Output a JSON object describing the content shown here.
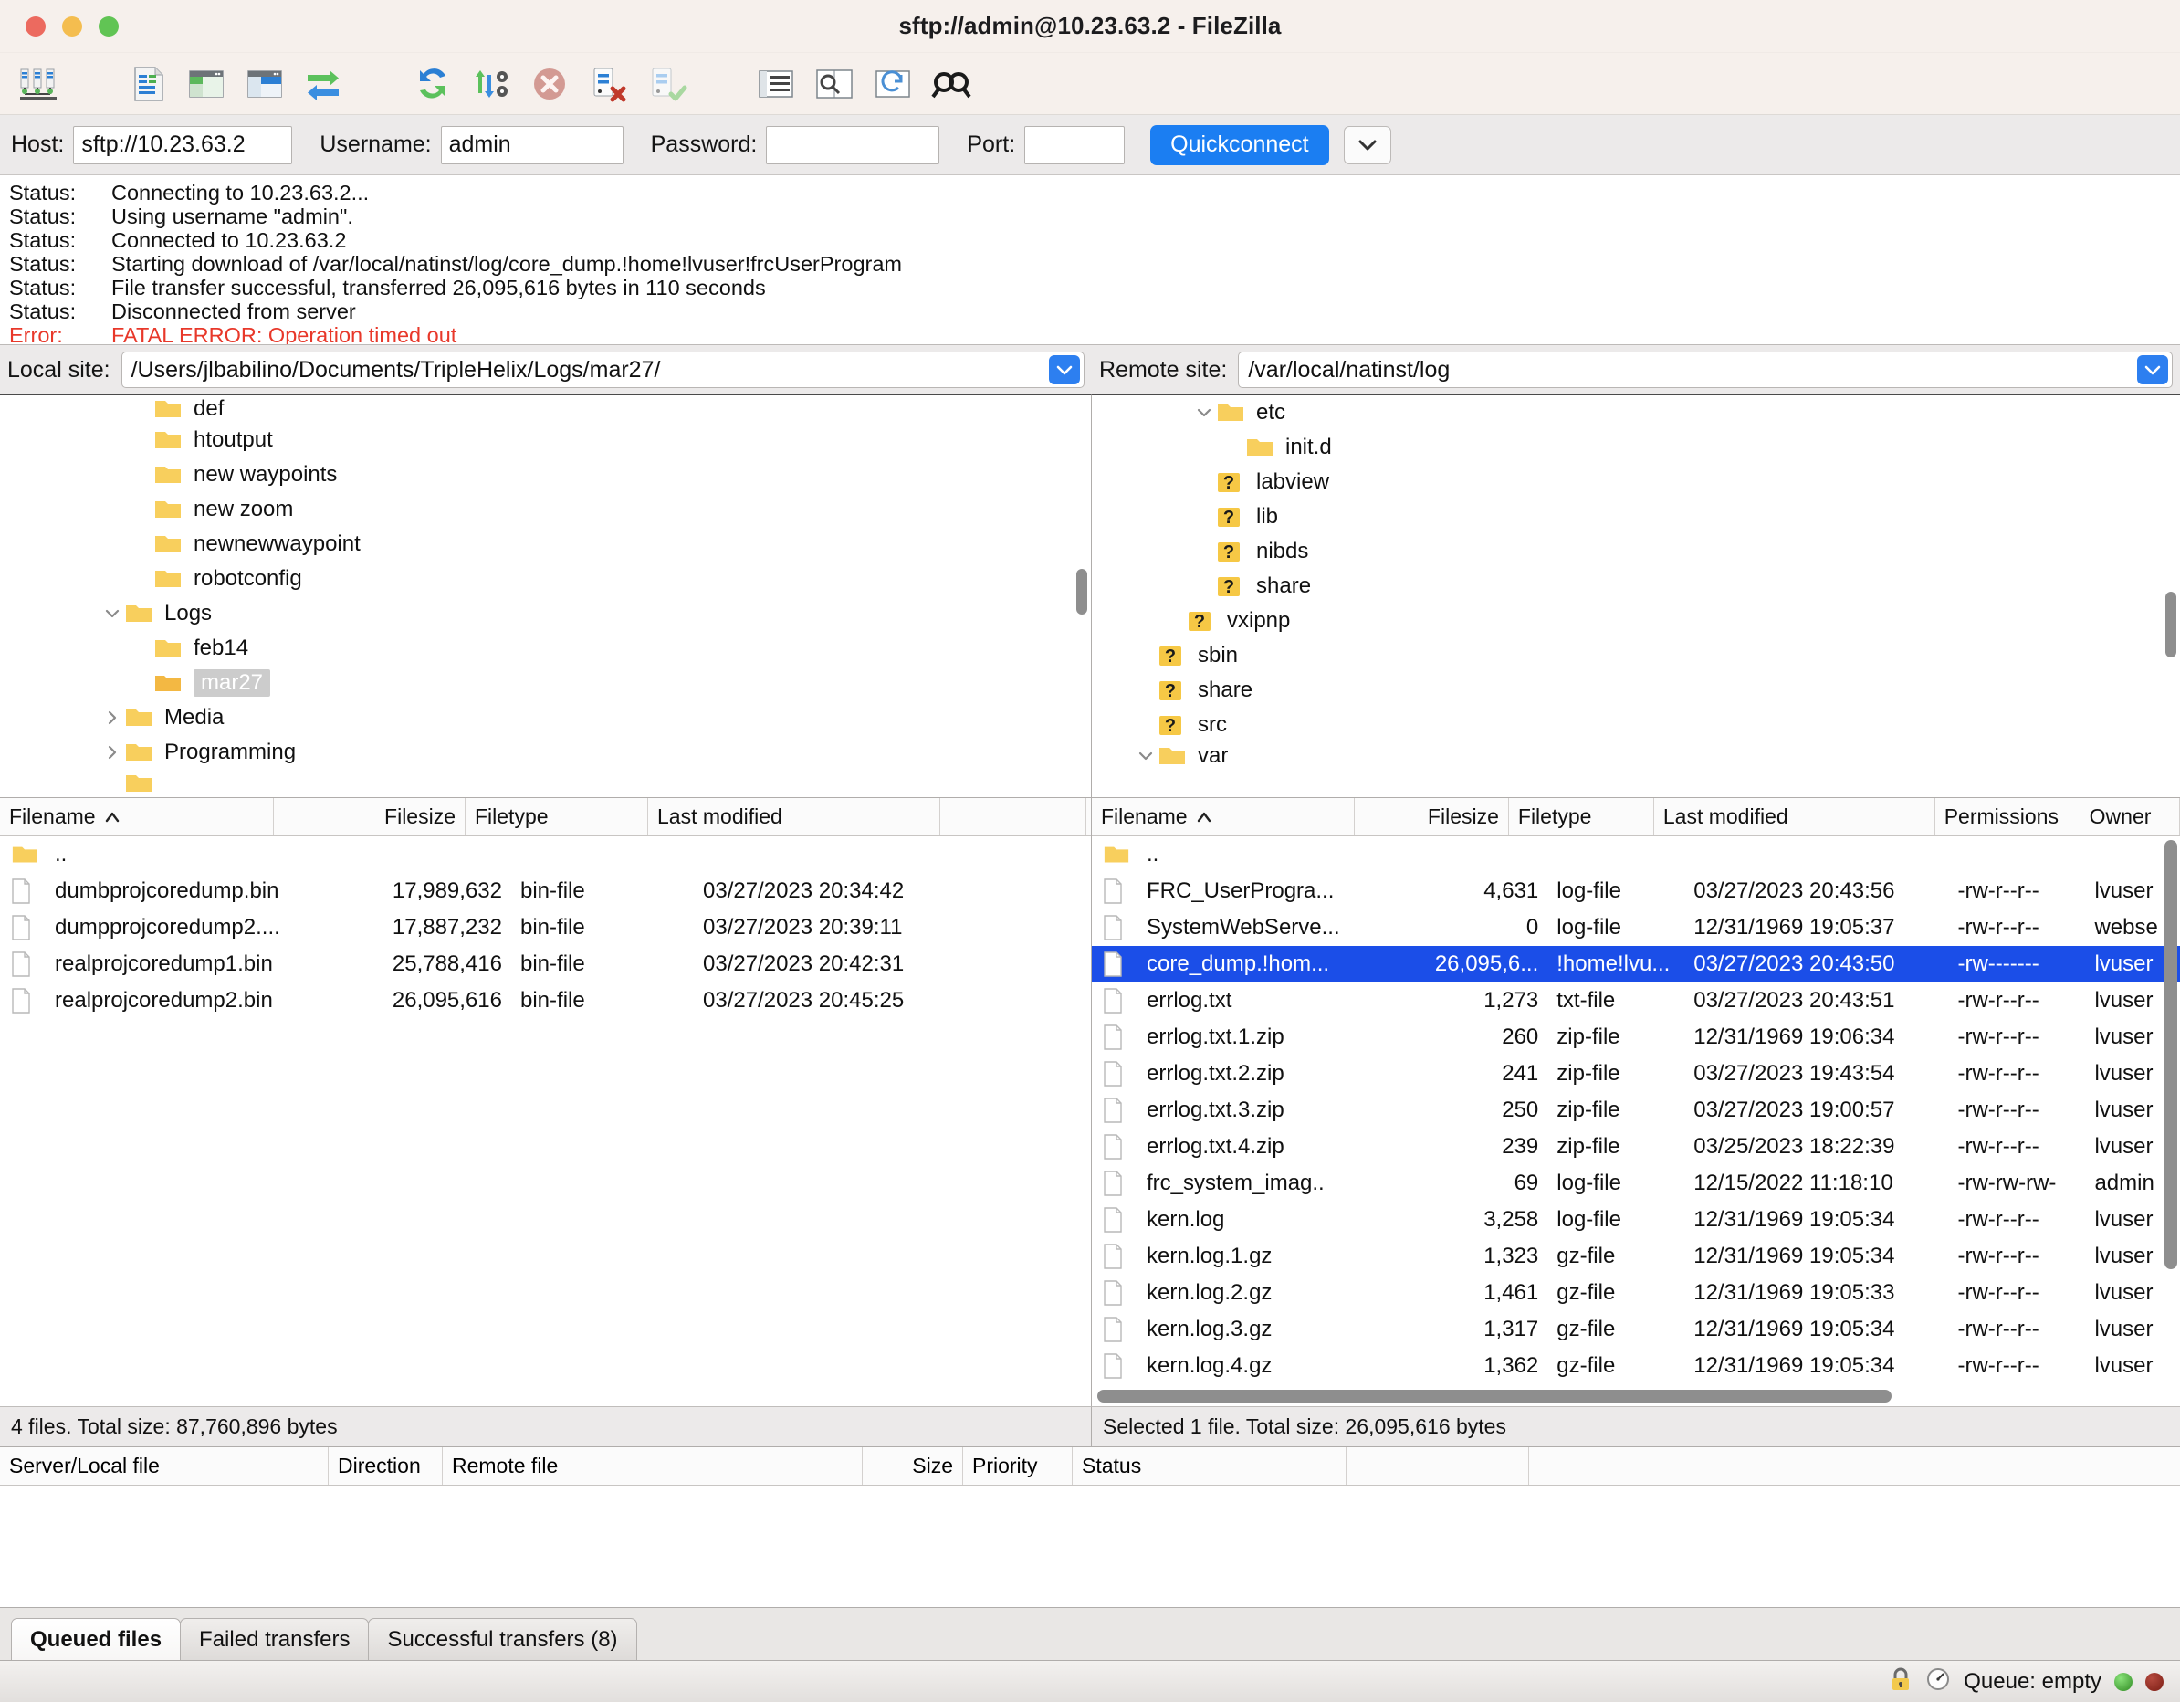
{
  "window": {
    "title": "sftp://admin@10.23.63.2 - FileZilla"
  },
  "toolbar": {
    "items": [
      {
        "name": "site-manager-icon",
        "label": "Open the Site Manager"
      },
      {
        "name": "toggle-message-log-icon",
        "label": "Toggle message log"
      },
      {
        "name": "toggle-local-tree-icon",
        "label": "Toggle local directory tree"
      },
      {
        "name": "toggle-remote-tree-icon",
        "label": "Toggle remote directory tree"
      },
      {
        "name": "toggle-transfer-queue-icon",
        "label": "Toggle transfer queue"
      },
      {
        "name": "refresh-icon",
        "label": "Refresh"
      },
      {
        "name": "process-queue-icon",
        "label": "Process queue"
      },
      {
        "name": "cancel-icon",
        "label": "Cancel current operation"
      },
      {
        "name": "disconnect-icon",
        "label": "Disconnect from server"
      },
      {
        "name": "reconnect-icon",
        "label": "Reconnect to last used server"
      },
      {
        "name": "filter-icon",
        "label": "Directory listing filters"
      },
      {
        "name": "compare-directories-icon",
        "label": "Compare directory listings"
      },
      {
        "name": "synchronized-browsing-icon",
        "label": "Toggle synchronized browsing"
      },
      {
        "name": "find-files-icon",
        "label": "Search remote files"
      }
    ]
  },
  "quickconnect": {
    "host_label": "Host:",
    "host_value": "sftp://10.23.63.2",
    "username_label": "Username:",
    "username_value": "admin",
    "password_label": "Password:",
    "password_value": "",
    "port_label": "Port:",
    "port_value": "",
    "connect_label": "Quickconnect",
    "dropdown_icon": "chevron-down-icon"
  },
  "log": {
    "lines": [
      {
        "label": "Status:",
        "text": "Connecting to 10.23.63.2...",
        "type": "status"
      },
      {
        "label": "Status:",
        "text": "Using username \"admin\".",
        "type": "status"
      },
      {
        "label": "Status:",
        "text": "Connected to 10.23.63.2",
        "type": "status"
      },
      {
        "label": "Status:",
        "text": "Starting download of /var/local/natinst/log/core_dump.!home!lvuser!frcUserProgram",
        "type": "status"
      },
      {
        "label": "Status:",
        "text": "File transfer successful, transferred 26,095,616 bytes in 110 seconds",
        "type": "status"
      },
      {
        "label": "Status:",
        "text": "Disconnected from server",
        "type": "status"
      },
      {
        "label": "Error:",
        "text": "FATAL ERROR: Operation timed out",
        "type": "error"
      }
    ],
    "error_color": "#e8382a"
  },
  "local": {
    "site_label": "Local site:",
    "site_path": "/Users/jlbabilino/Documents/TripleHelix/Logs/mar27/",
    "tree": [
      {
        "label": "def",
        "indent": 4,
        "twist": "",
        "icon": "folder-icon",
        "selected": false,
        "clipped": true
      },
      {
        "label": "htoutput",
        "indent": 4,
        "twist": "",
        "icon": "folder-icon",
        "selected": false
      },
      {
        "label": "new waypoints",
        "indent": 4,
        "twist": "",
        "icon": "folder-icon",
        "selected": false
      },
      {
        "label": "new zoom",
        "indent": 4,
        "twist": "",
        "icon": "folder-icon",
        "selected": false
      },
      {
        "label": "newnewwaypoint",
        "indent": 4,
        "twist": "",
        "icon": "folder-icon",
        "selected": false
      },
      {
        "label": "robotconfig",
        "indent": 4,
        "twist": "",
        "icon": "folder-icon",
        "selected": false
      },
      {
        "label": "Logs",
        "indent": 3,
        "twist": "expanded",
        "icon": "folder-icon",
        "selected": false
      },
      {
        "label": "feb14",
        "indent": 4,
        "twist": "",
        "icon": "folder-icon",
        "selected": false
      },
      {
        "label": "mar27",
        "indent": 4,
        "twist": "",
        "icon": "folder-open-icon",
        "selected": true
      },
      {
        "label": "Media",
        "indent": 3,
        "twist": "collapsed",
        "icon": "folder-icon",
        "selected": false
      },
      {
        "label": "Programming",
        "indent": 3,
        "twist": "collapsed",
        "icon": "folder-icon",
        "selected": false
      },
      {
        "label": "",
        "indent": 3,
        "twist": "",
        "icon": "folder-icon",
        "selected": false,
        "clipped": true
      }
    ],
    "columns": [
      "Filename",
      "Filesize",
      "Filetype",
      "Last modified",
      ""
    ],
    "sort_indicator": "sort-ascending-icon",
    "rows": [
      {
        "name": "..",
        "size": "",
        "type": "",
        "modified": "",
        "icon": "folder-icon"
      },
      {
        "name": "dumbprojcoredump.bin",
        "size": "17,989,632",
        "type": "bin-file",
        "modified": "03/27/2023 20:34:42",
        "icon": "file-icon"
      },
      {
        "name": "dumpprojcoredump2....",
        "size": "17,887,232",
        "type": "bin-file",
        "modified": "03/27/2023 20:39:11",
        "icon": "file-icon"
      },
      {
        "name": "realprojcoredump1.bin",
        "size": "25,788,416",
        "type": "bin-file",
        "modified": "03/27/2023 20:42:31",
        "icon": "file-icon"
      },
      {
        "name": "realprojcoredump2.bin",
        "size": "26,095,616",
        "type": "bin-file",
        "modified": "03/27/2023 20:45:25",
        "icon": "file-icon"
      }
    ],
    "status": "4 files. Total size: 87,760,896 bytes"
  },
  "remote": {
    "site_label": "Remote site:",
    "site_path": "/var/local/natinst/log",
    "tree": [
      {
        "label": "etc",
        "indent": 3,
        "twist": "expanded",
        "icon": "folder-icon",
        "selected": false
      },
      {
        "label": "init.d",
        "indent": 4,
        "twist": "",
        "icon": "folder-icon",
        "selected": false
      },
      {
        "label": "labview",
        "indent": 3,
        "twist": "",
        "icon": "unknown-folder-icon",
        "selected": false
      },
      {
        "label": "lib",
        "indent": 3,
        "twist": "",
        "icon": "unknown-folder-icon",
        "selected": false
      },
      {
        "label": "nibds",
        "indent": 3,
        "twist": "",
        "icon": "unknown-folder-icon",
        "selected": false
      },
      {
        "label": "share",
        "indent": 3,
        "twist": "",
        "icon": "unknown-folder-icon",
        "selected": false
      },
      {
        "label": "vxipnp",
        "indent": 2,
        "twist": "",
        "icon": "unknown-folder-icon",
        "selected": false
      },
      {
        "label": "sbin",
        "indent": 1,
        "twist": "",
        "icon": "unknown-folder-icon",
        "selected": false
      },
      {
        "label": "share",
        "indent": 1,
        "twist": "",
        "icon": "unknown-folder-icon",
        "selected": false
      },
      {
        "label": "src",
        "indent": 1,
        "twist": "",
        "icon": "unknown-folder-icon",
        "selected": false
      },
      {
        "label": "var",
        "indent": 1,
        "twist": "expanded",
        "icon": "folder-icon",
        "selected": false,
        "clipped": true
      }
    ],
    "columns": [
      "Filename",
      "Filesize",
      "Filetype",
      "Last modified",
      "Permissions",
      "Owner"
    ],
    "sort_indicator": "sort-ascending-icon",
    "rows": [
      {
        "name": "..",
        "size": "",
        "type": "",
        "modified": "",
        "perm": "",
        "owner": "",
        "icon": "folder-icon",
        "selected": false
      },
      {
        "name": "FRC_UserProgra...",
        "size": "4,631",
        "type": "log-file",
        "modified": "03/27/2023 20:43:56",
        "perm": "-rw-r--r--",
        "owner": "lvuser",
        "icon": "file-icon",
        "selected": false
      },
      {
        "name": "SystemWebServe...",
        "size": "0",
        "type": "log-file",
        "modified": "12/31/1969 19:05:37",
        "perm": "-rw-r--r--",
        "owner": "webse",
        "icon": "file-icon",
        "selected": false
      },
      {
        "name": "core_dump.!hom...",
        "size": "26,095,6...",
        "type": "!home!lvu...",
        "modified": "03/27/2023 20:43:50",
        "perm": "-rw-------",
        "owner": "lvuser",
        "icon": "file-icon",
        "selected": true
      },
      {
        "name": "errlog.txt",
        "size": "1,273",
        "type": "txt-file",
        "modified": "03/27/2023 20:43:51",
        "perm": "-rw-r--r--",
        "owner": "lvuser",
        "icon": "file-icon",
        "selected": false
      },
      {
        "name": "errlog.txt.1.zip",
        "size": "260",
        "type": "zip-file",
        "modified": "12/31/1969 19:06:34",
        "perm": "-rw-r--r--",
        "owner": "lvuser",
        "icon": "file-icon",
        "selected": false
      },
      {
        "name": "errlog.txt.2.zip",
        "size": "241",
        "type": "zip-file",
        "modified": "03/27/2023 19:43:54",
        "perm": "-rw-r--r--",
        "owner": "lvuser",
        "icon": "file-icon",
        "selected": false
      },
      {
        "name": "errlog.txt.3.zip",
        "size": "250",
        "type": "zip-file",
        "modified": "03/27/2023 19:00:57",
        "perm": "-rw-r--r--",
        "owner": "lvuser",
        "icon": "file-icon",
        "selected": false
      },
      {
        "name": "errlog.txt.4.zip",
        "size": "239",
        "type": "zip-file",
        "modified": "03/25/2023 18:22:39",
        "perm": "-rw-r--r--",
        "owner": "lvuser",
        "icon": "file-icon",
        "selected": false
      },
      {
        "name": "frc_system_imag..",
        "size": "69",
        "type": "log-file",
        "modified": "12/15/2022 11:18:10",
        "perm": "-rw-rw-rw-",
        "owner": "admin",
        "icon": "file-icon",
        "selected": false
      },
      {
        "name": "kern.log",
        "size": "3,258",
        "type": "log-file",
        "modified": "12/31/1969 19:05:34",
        "perm": "-rw-r--r--",
        "owner": "lvuser",
        "icon": "file-icon",
        "selected": false
      },
      {
        "name": "kern.log.1.gz",
        "size": "1,323",
        "type": "gz-file",
        "modified": "12/31/1969 19:05:34",
        "perm": "-rw-r--r--",
        "owner": "lvuser",
        "icon": "file-icon",
        "selected": false
      },
      {
        "name": "kern.log.2.gz",
        "size": "1,461",
        "type": "gz-file",
        "modified": "12/31/1969 19:05:33",
        "perm": "-rw-r--r--",
        "owner": "lvuser",
        "icon": "file-icon",
        "selected": false
      },
      {
        "name": "kern.log.3.gz",
        "size": "1,317",
        "type": "gz-file",
        "modified": "12/31/1969 19:05:34",
        "perm": "-rw-r--r--",
        "owner": "lvuser",
        "icon": "file-icon",
        "selected": false
      },
      {
        "name": "kern.log.4.gz",
        "size": "1,362",
        "type": "gz-file",
        "modified": "12/31/1969 19:05:34",
        "perm": "-rw-r--r--",
        "owner": "lvuser",
        "icon": "file-icon",
        "selected": false
      }
    ],
    "status": "Selected 1 file. Total size: 26,095,616 bytes",
    "selection_color": "#1b4ee8"
  },
  "queue": {
    "columns": [
      "Server/Local file",
      "Direction",
      "Remote file",
      "Size",
      "Priority",
      "Status"
    ]
  },
  "tabs": [
    {
      "label": "Queued files",
      "active": true
    },
    {
      "label": "Failed transfers",
      "active": false
    },
    {
      "label": "Successful transfers (8)",
      "active": false
    }
  ],
  "statusbar": {
    "lock_icon": "lock-icon",
    "speed_icon": "speedometer-icon",
    "queue_text": "Queue: empty",
    "led_green": "#2f8a22",
    "led_red": "#7b1d14"
  }
}
